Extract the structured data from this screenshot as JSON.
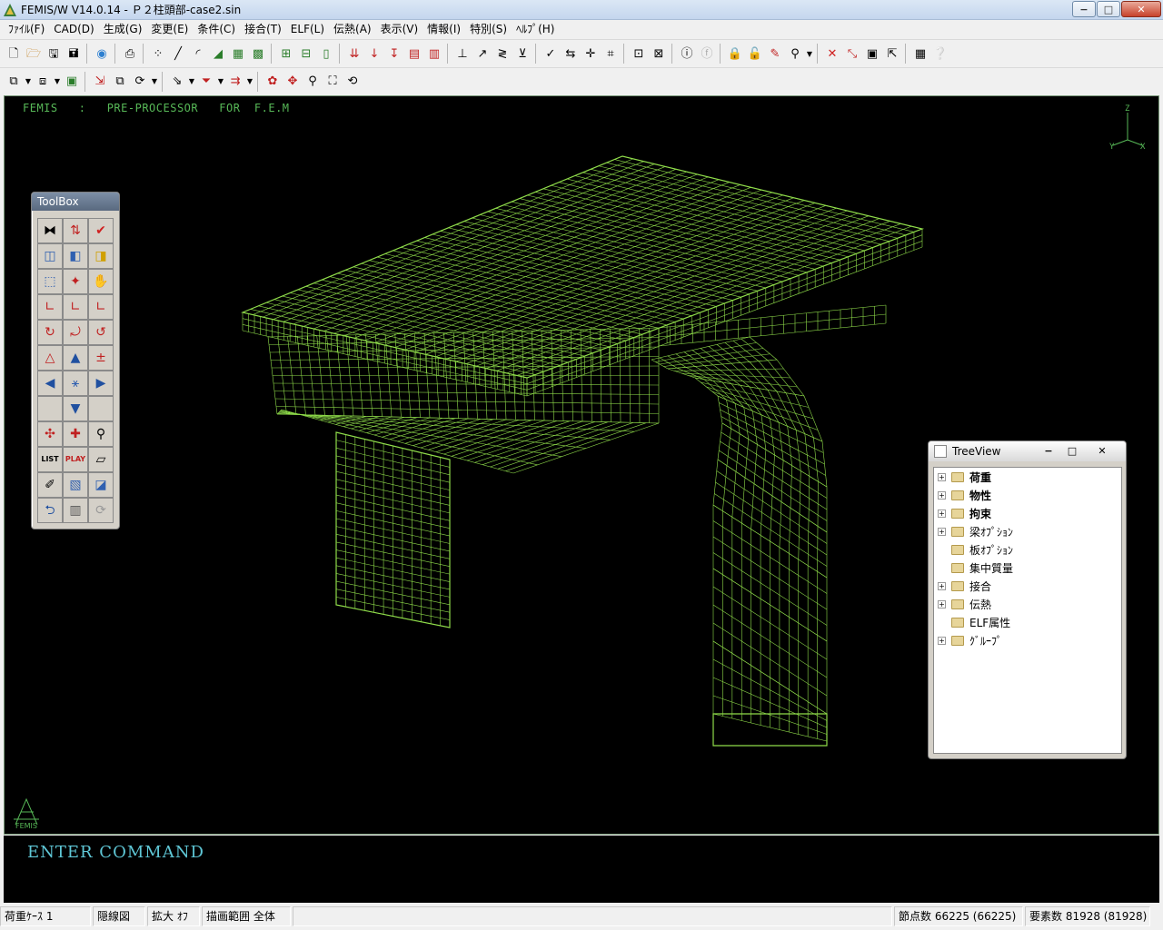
{
  "window": {
    "title": "FEMIS/W V14.0.14 - Ｐ２柱頭部-case2.sin",
    "minimize": "−",
    "maximize": "□",
    "close": "✕"
  },
  "menu": [
    "ﾌｧｲﾙ(F)",
    "CAD(D)",
    "生成(G)",
    "変更(E)",
    "条件(C)",
    "接合(T)",
    "ELF(L)",
    "伝熱(A)",
    "表示(V)",
    "情報(I)",
    "特別(S)",
    "ﾍﾙﾌﾟ(H)"
  ],
  "toolbar1": {
    "icons": [
      "new-file-icon",
      "open-file-icon",
      "save-icon",
      "save-as-icon",
      "print-preview-icon",
      "world-icon",
      "printer-icon",
      "node-grid-icon",
      "line-icon",
      "arc-icon",
      "triangle-icon",
      "grid-icon",
      "mesh-icon",
      "frame-icon",
      "frame2-icon",
      "beam-icon",
      "load-icon",
      "force-down-icon",
      "force-arrow-icon",
      "red-mesh-icon",
      "red-mesh2-icon",
      "support-icon",
      "pin-icon",
      "spring-icon",
      "fix-icon",
      "check-icon",
      "dim-icon",
      "cross-icon",
      "graph-icon",
      "measure-icon",
      "measure2-icon",
      "info-icon",
      "disabled-icon",
      "lock-icon",
      "lock2-icon",
      "edit-icon",
      "search-icon",
      "delete-icon",
      "connect-icon",
      "panel-icon",
      "arrow-icon",
      "table-icon",
      "help-icon"
    ]
  },
  "toolbar2": {
    "icons": [
      "layer-icon",
      "layer2-icon",
      "export-icon",
      "move-icon",
      "copy-icon",
      "rotate-icon",
      "select-icon",
      "filter-icon",
      "render-icon",
      "color-icon",
      "pan-icon",
      "zoom-icon",
      "fit-icon",
      "refresh-icon"
    ]
  },
  "viewport": {
    "header": "FEMIS   :   PRE-PROCESSOR   FOR  F.E.M",
    "axis_labels": {
      "z": "Z",
      "y": "Y",
      "x": "X"
    },
    "logo": "FEMIS",
    "colors": {
      "background": "#000000",
      "mesh": "#8fdc4a",
      "header": "#57b857"
    }
  },
  "toolbox": {
    "title": "ToolBox",
    "buttons": [
      "mirror-icon",
      "node-link-icon",
      "checkmark-icon",
      "cube-front-icon",
      "cube-side-icon",
      "cube-yellow-icon",
      "cube-wire-icon",
      "cube-light-icon",
      "hand-icon",
      "axis-yx-icon",
      "axis-zx-icon",
      "axis-zy-icon",
      "rotate-x-icon",
      "rotate-y-icon",
      "rotate-z-icon",
      "perspective-icon",
      "arrow-up-icon",
      "plus-minus-icon",
      "arrow-left-icon",
      "axes-3d-icon",
      "arrow-right-icon",
      "blank-icon",
      "arrow-down-icon",
      "blank2-icon",
      "orbit-icon",
      "pan-cross-icon",
      "magnify-icon",
      "list-icon",
      "play-icon",
      "eraser-icon",
      "note-icon",
      "hatch-icon",
      "layer-blue-icon",
      "undo-icon",
      "contour-icon",
      "redo-icon"
    ],
    "labels": {
      "list": "LIST",
      "play": "PLAY"
    }
  },
  "treeview": {
    "title": "TreeView",
    "items": [
      {
        "label": "荷重",
        "expandable": true,
        "bold": true
      },
      {
        "label": "物性",
        "expandable": true,
        "bold": true
      },
      {
        "label": "拘束",
        "expandable": true,
        "bold": true
      },
      {
        "label": "梁ｵﾌﾟｼｮﾝ",
        "expandable": true,
        "bold": false
      },
      {
        "label": "板ｵﾌﾟｼｮﾝ",
        "expandable": false,
        "bold": false
      },
      {
        "label": "集中質量",
        "expandable": false,
        "bold": false
      },
      {
        "label": "接合",
        "expandable": true,
        "bold": false
      },
      {
        "label": "伝熱",
        "expandable": true,
        "bold": false
      },
      {
        "label": "ELF属性",
        "expandable": false,
        "bold": false
      },
      {
        "label": "ｸﾞﾙｰﾌﾟ",
        "expandable": true,
        "bold": false
      }
    ]
  },
  "command": {
    "prompt": "ENTER COMMAND"
  },
  "status": {
    "load_case": "荷重ｹｰｽ 1",
    "hidden_line": "隠線図",
    "zoom": "拡大 ｵﾌ",
    "draw_range": "描画範囲 全体",
    "nodes": "節点数 66225 (66225)",
    "elements": "要素数 81928 (81928)"
  }
}
